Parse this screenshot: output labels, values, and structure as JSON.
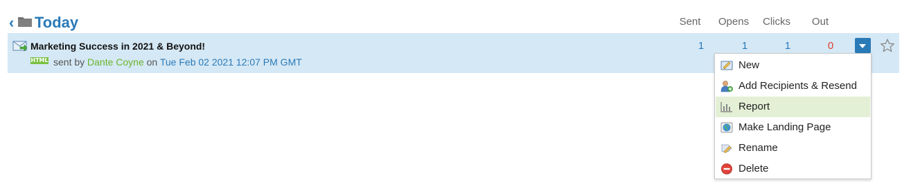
{
  "header": {
    "title": "Today",
    "columns": [
      "Sent",
      "Opens",
      "Clicks",
      "Out"
    ]
  },
  "message": {
    "subject": "Marketing Success in 2021 & Beyond!",
    "format_badge": "HTML",
    "sent_by_prefix": "sent by",
    "author": "Dante Coyne",
    "on_text": "on",
    "date": "Tue Feb 02 2021 12:07 PM GMT",
    "stats": {
      "sent": "1",
      "opens": "1",
      "clicks": "1",
      "out": "0"
    }
  },
  "menu": {
    "items": [
      {
        "label": "New",
        "icon": "new-doc-icon"
      },
      {
        "label": "Add Recipients & Resend",
        "icon": "add-user-icon"
      },
      {
        "label": "Report",
        "icon": "bar-chart-icon",
        "highlighted": true
      },
      {
        "label": "Make Landing Page",
        "icon": "globe-icon"
      },
      {
        "label": "Rename",
        "icon": "rename-tag-icon"
      },
      {
        "label": "Delete",
        "icon": "delete-icon"
      }
    ]
  },
  "colors": {
    "accent_blue": "#2a7ab8",
    "row_highlight": "#d5e8f5",
    "author_green": "#6ab42d",
    "out_red": "#e03c31",
    "menu_active": "#e4f0d6"
  }
}
